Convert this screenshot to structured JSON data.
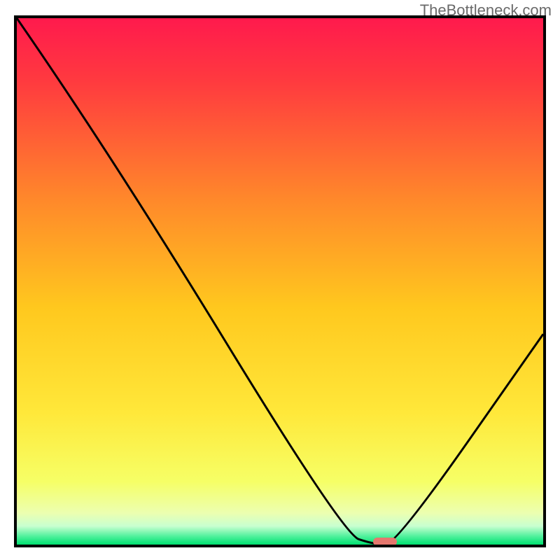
{
  "watermark": "TheBottleneck.com",
  "chart_data": {
    "type": "line",
    "title": "",
    "xlabel": "",
    "ylabel": "",
    "xlim": [
      0,
      100
    ],
    "ylim": [
      0,
      100
    ],
    "grid": false,
    "legend": false,
    "series": [
      {
        "name": "bottleneck-curve",
        "x": [
          0,
          18,
          62,
          68,
          72,
          100
        ],
        "y": [
          100,
          74,
          2,
          0,
          0,
          40
        ]
      }
    ],
    "background_gradient": {
      "top_color": "#ff1a4d",
      "mid_color": "#ffd500",
      "green_band_color": "#00f07a",
      "green_band_y": 4
    },
    "marker": {
      "name": "optimal-point",
      "x": 70,
      "y": 0,
      "color": "#e6776e"
    }
  }
}
